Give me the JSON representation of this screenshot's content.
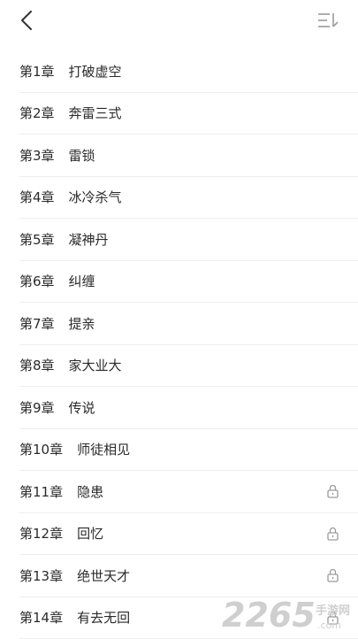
{
  "header": {
    "back_icon": "chevron-left-icon",
    "sort_icon": "sort-order-icon"
  },
  "chapters": [
    {
      "num": "第1章",
      "title": "打破虚空",
      "locked": false
    },
    {
      "num": "第2章",
      "title": "奔雷三式",
      "locked": false
    },
    {
      "num": "第3章",
      "title": "雷锁",
      "locked": false
    },
    {
      "num": "第4章",
      "title": "冰冷杀气",
      "locked": false
    },
    {
      "num": "第5章",
      "title": "凝神丹",
      "locked": false
    },
    {
      "num": "第6章",
      "title": "纠缠",
      "locked": false
    },
    {
      "num": "第7章",
      "title": "提亲",
      "locked": false
    },
    {
      "num": "第8章",
      "title": "家大业大",
      "locked": false
    },
    {
      "num": "第9章",
      "title": "传说",
      "locked": false
    },
    {
      "num": "第10章",
      "title": "师徒相见",
      "locked": false
    },
    {
      "num": "第11章",
      "title": "隐患",
      "locked": true
    },
    {
      "num": "第12章",
      "title": "回忆",
      "locked": true
    },
    {
      "num": "第13章",
      "title": "绝世天才",
      "locked": true
    },
    {
      "num": "第14章",
      "title": "有去无回",
      "locked": true
    }
  ],
  "watermark": {
    "brand": "2265",
    "brand_suffix": "手游网",
    "domain": ".com"
  },
  "colors": {
    "text": "#2a2a2a",
    "divider": "#eeeeee",
    "icon": "#9a9a9a",
    "watermark": "#cfcfcf"
  }
}
